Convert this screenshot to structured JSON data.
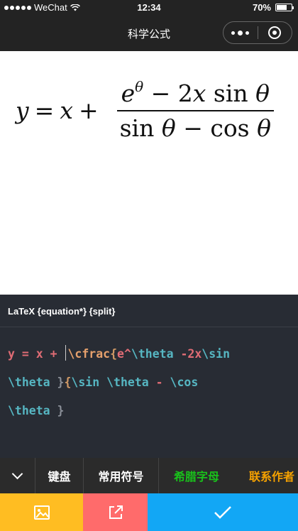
{
  "status_bar": {
    "carrier": "WeChat",
    "time": "12:34",
    "battery_percent": "70%",
    "battery_level": 0.7,
    "signal_dots_filled": 5
  },
  "nav": {
    "title": "科学公式"
  },
  "formula": {
    "lhs": "y = x +",
    "numerator": "e^θ − 2x sin θ",
    "denominator": "sin θ − cos θ"
  },
  "editor": {
    "header": "LaTeX {equation*} {split}",
    "code_lines": [
      "y = x + \\cfrac{e^\\theta -2x\\sin",
      "\\theta }{\\sin \\theta - \\cos",
      "\\theta }"
    ]
  },
  "tabs": {
    "collapse_icon": "chevron-down-icon",
    "items": [
      "键盘",
      "常用符号",
      "希腊字母",
      "联系作者"
    ],
    "colors": {
      "greek": "#19c21b",
      "contact": "#f6a200"
    }
  },
  "actions": {
    "image_icon": "image-icon",
    "share_icon": "external-link-icon",
    "confirm_icon": "check-icon",
    "colors": {
      "image": "#ffbd22",
      "share": "#ff6b6b",
      "confirm": "#12a7f5"
    }
  }
}
